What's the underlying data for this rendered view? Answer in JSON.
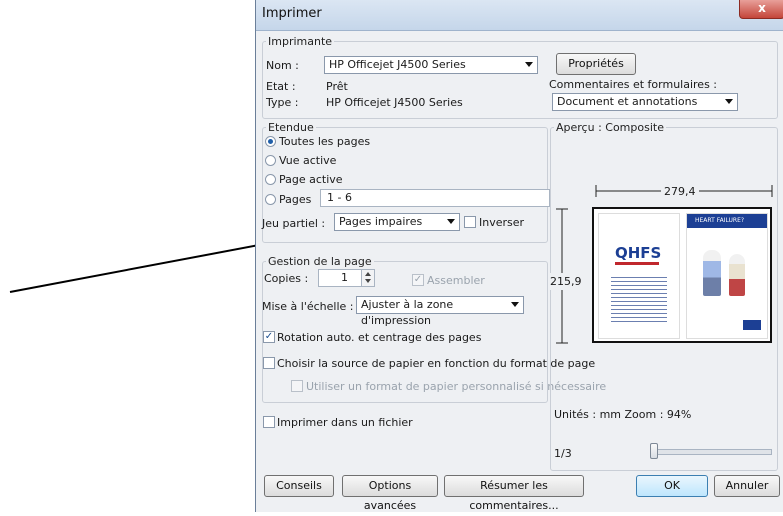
{
  "dialog": {
    "title": "Imprimer",
    "close_glyph": "x"
  },
  "printer": {
    "group_label": "Imprimante",
    "name_label": "Nom :",
    "name_value": "HP Officejet J4500 Series",
    "state_label": "Etat :",
    "state_value": "Prêt",
    "type_label": "Type :",
    "type_value": "HP Officejet J4500 Series",
    "properties_button": "Propriétés",
    "comments_label": "Commentaires et formulaires :",
    "comments_value": "Document et annotations"
  },
  "range": {
    "group_label": "Etendue",
    "all_pages": "Toutes les pages",
    "active_view": "Vue active",
    "active_page": "Page active",
    "pages": "Pages",
    "pages_value": "1 - 6",
    "subset_label": "Jeu partiel :",
    "subset_value": "Pages impaires",
    "reverse": "Inverser"
  },
  "page_handling": {
    "group_label": "Gestion de la page",
    "copies_label": "Copies :",
    "copies_value": "1",
    "collate": "Assembler",
    "scaling_label": "Mise à l'échelle :",
    "scaling_value": "Ajuster à la zone d'impression",
    "auto_rotate": "Rotation auto. et centrage des pages",
    "choose_source": "Choisir la source de papier en fonction du format de page",
    "custom_paper": "Utiliser un format de papier personnalisé si nécessaire"
  },
  "print_to_file": "Imprimer dans un fichier",
  "preview": {
    "label": "Aperçu : Composite",
    "width_value": "279,4",
    "height_value": "215,9",
    "doc_logo": "QHFS",
    "doc_header": "HEART FAILURE?",
    "units_zoom": "Unités : mm Zoom :  94%",
    "page_indicator": "1/3",
    "slider_level": 0.0
  },
  "buttons": {
    "tips": "Conseils",
    "advanced": "Options avancées",
    "summarize": "Résumer les commentaires...",
    "ok": "OK",
    "cancel": "Annuler"
  }
}
